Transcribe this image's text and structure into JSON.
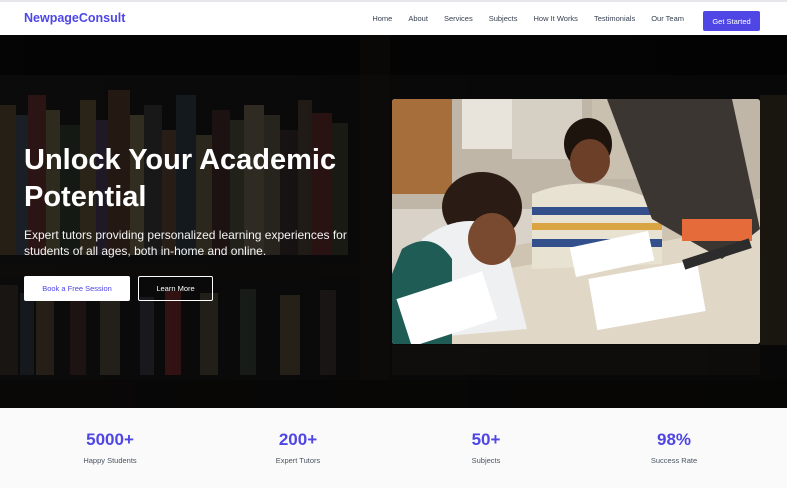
{
  "nav": {
    "brand": "NewpageConsult",
    "links": [
      "Home",
      "About",
      "Services",
      "Subjects",
      "How It Works",
      "Testimonials",
      "Our Team"
    ],
    "cta": "Get Started"
  },
  "hero": {
    "title": "Unlock Your Academic Potential",
    "subtitle": "Expert tutors providing personalized learning experiences for students of all ages, both in-home and online.",
    "primary_button": "Book a Free Session",
    "secondary_button": "Learn More"
  },
  "stats": [
    {
      "value": "5000+",
      "label": "Happy Students"
    },
    {
      "value": "200+",
      "label": "Expert Tutors"
    },
    {
      "value": "50+",
      "label": "Subjects"
    },
    {
      "value": "98%",
      "label": "Success Rate"
    }
  ],
  "colors": {
    "accent": "#4f46e5",
    "hero_overlay": "#000000"
  }
}
